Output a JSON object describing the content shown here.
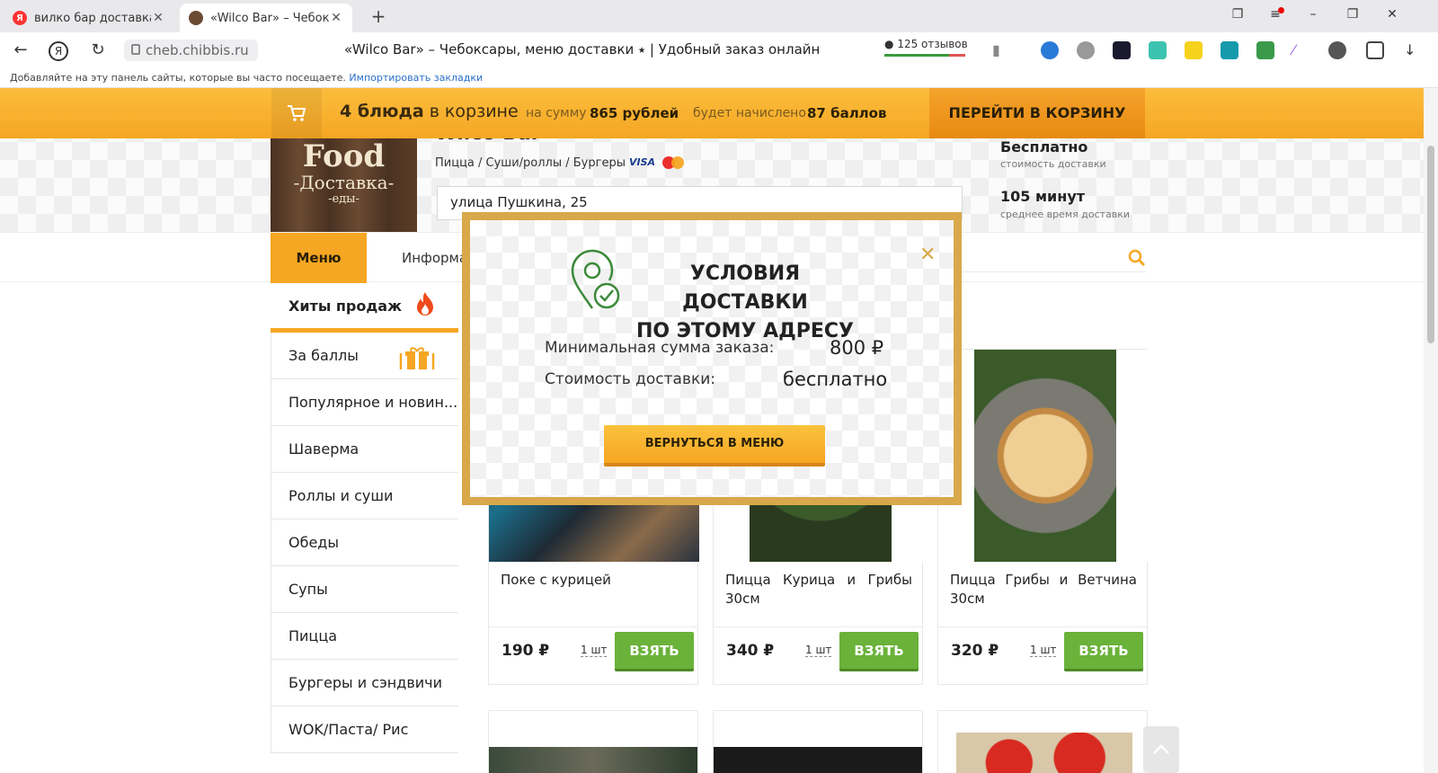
{
  "browser": {
    "tabs": [
      {
        "label": "вилко бар доставка чебок",
        "active": false
      },
      {
        "label": "«Wilco Bar» – Чебоксар",
        "active": true
      }
    ],
    "url": "cheb.chibbis.ru",
    "page_title": "«Wilco Bar» – Чебоксары, меню доставки ⭑ | Удобный заказ онлайн",
    "reviews": "125 отзывов",
    "bookmarks_text": "Добавляйте на эту панель сайты, которые вы часто посещаете.",
    "bookmarks_link": "Импортировать закладки"
  },
  "cart": {
    "count_bold": "4 блюда",
    "count_rest": " в корзине",
    "sum_label": "на сумму",
    "sum_value": "865 рублей",
    "points_label": "будет начислено",
    "points_value": "87 баллов",
    "go_button": "ПЕРЕЙТИ В КОРЗИНУ"
  },
  "restaurant": {
    "logo": {
      "line1": "Food",
      "line2": "-Доставка-",
      "line3": "-еды-"
    },
    "name": "Wilco Bar",
    "categories": "Пицца / Суши/роллы / Бургеры",
    "cards": {
      "visa": "VISA"
    },
    "address": "улица Пушкина, 25",
    "delivery_cost_value": "Бесплатно",
    "delivery_cost_label": "стоимость доставки",
    "delivery_time_value": "105 минут",
    "delivery_time_label": "среднее время доставки"
  },
  "nav": {
    "menu_tab": "Меню",
    "info_tab": "Информа",
    "search_placeholder": "а"
  },
  "sidebar": {
    "hits": "Хиты продаж",
    "items": [
      "За баллы",
      "Популярное и новин...",
      "Шаверма",
      "Роллы и суши",
      "Обеды",
      "Супы",
      "Пицца",
      "Бургеры и сэндвичи",
      "WOK/Паста/ Рис"
    ]
  },
  "products": [
    {
      "name": "Поке с курицей",
      "price": "190 ₽",
      "qty": "1 шт",
      "button": "ВЗЯТЬ"
    },
    {
      "name": "Пицца Курица и Грибы 30см",
      "price": "340 ₽",
      "qty": "1 шт",
      "button": "ВЗЯТЬ"
    },
    {
      "name": "Пицца Грибы и Ветчина 30см",
      "price": "320 ₽",
      "qty": "1 шт",
      "button": "ВЗЯТЬ"
    }
  ],
  "modal": {
    "title_line1": "УСЛОВИЯ ДОСТАВКИ",
    "title_line2": "ПО ЭТОМУ АДРЕСУ",
    "min_label": "Минимальная сумма заказа:",
    "min_value": "800 ₽",
    "cost_label": "Стоимость доставки:",
    "cost_value": "бесплатно",
    "back_button": "ВЕРНУТЬСЯ В МЕНЮ",
    "close_symbol": "✕"
  },
  "colors": {
    "accent": "#f5a623",
    "take_button": "#6ab23a",
    "modal_border": "#d8a84a",
    "pin_icon": "#3c8a3a"
  }
}
